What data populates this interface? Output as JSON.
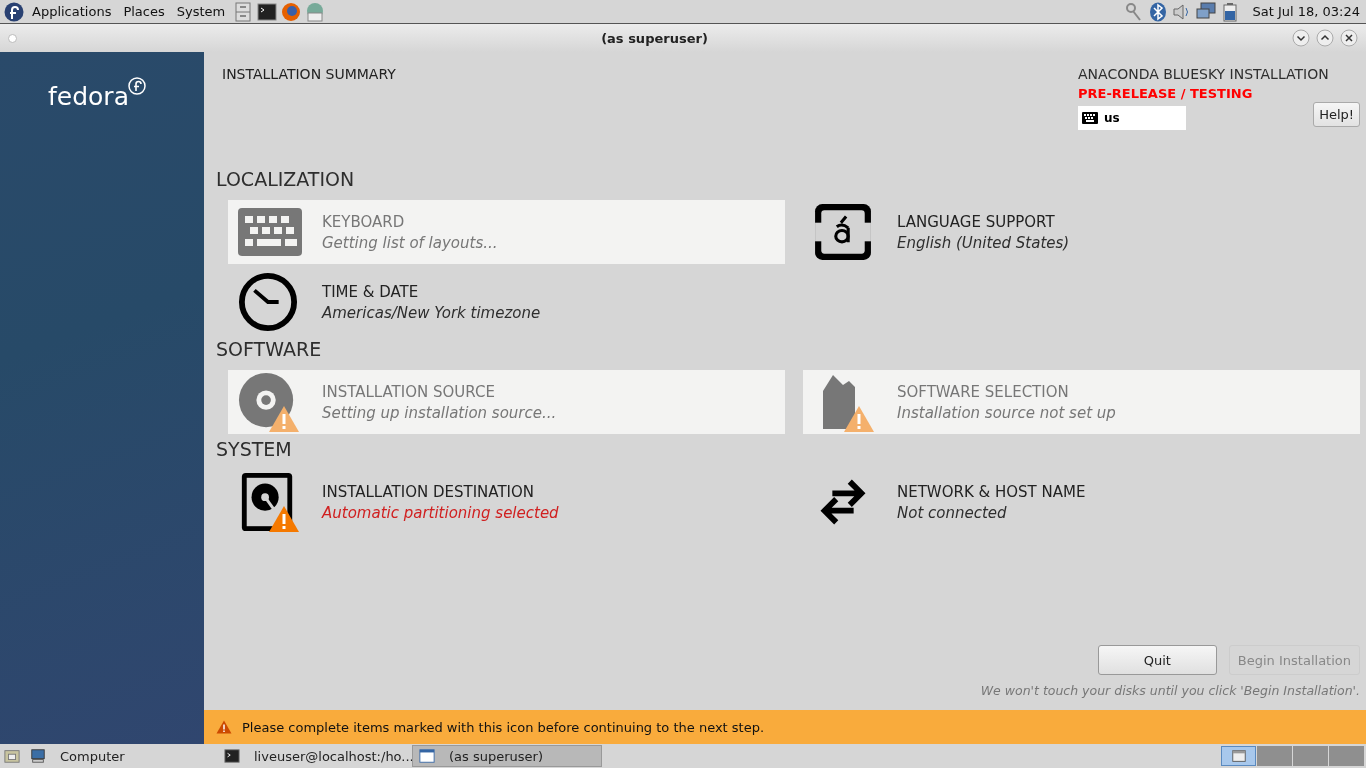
{
  "top_panel": {
    "menus": [
      "Applications",
      "Places",
      "System"
    ],
    "clock": "Sat Jul 18, 03:24"
  },
  "window": {
    "title": "(as superuser)"
  },
  "sidebar": {
    "logo_text": "fedora"
  },
  "header": {
    "title": "INSTALLATION SUMMARY",
    "product": "ANACONDA BLUESKY INSTALLATION",
    "prerelease": "PRE-RELEASE / TESTING",
    "layout": "us",
    "help": "Help!"
  },
  "sections": [
    {
      "title": "LOCALIZATION",
      "spokes": [
        {
          "kind": "keyboard",
          "title": "KEYBOARD",
          "status": "Getting list of layouts...",
          "disabled": true,
          "warning": false,
          "error": false
        },
        {
          "kind": "language",
          "title": "LANGUAGE SUPPORT",
          "status": "English (United States)",
          "disabled": false,
          "warning": false,
          "error": false
        },
        {
          "kind": "clock",
          "title": "TIME & DATE",
          "status": "Americas/New York timezone",
          "disabled": false,
          "warning": false,
          "error": false
        }
      ]
    },
    {
      "title": "SOFTWARE",
      "spokes": [
        {
          "kind": "disc",
          "title": "INSTALLATION SOURCE",
          "status": "Setting up installation source...",
          "disabled": true,
          "warning": true,
          "error": false
        },
        {
          "kind": "package",
          "title": "SOFTWARE SELECTION",
          "status": "Installation source not set up",
          "disabled": true,
          "warning": true,
          "error": false
        }
      ]
    },
    {
      "title": "SYSTEM",
      "spokes": [
        {
          "kind": "disk",
          "title": "INSTALLATION DESTINATION",
          "status": "Automatic partitioning selected",
          "disabled": false,
          "warning": true,
          "error": true
        },
        {
          "kind": "network",
          "title": "NETWORK & HOST NAME",
          "status": "Not connected",
          "disabled": false,
          "warning": false,
          "error": false
        }
      ]
    }
  ],
  "buttons": [
    {
      "label": "Quit",
      "disabled": false
    },
    {
      "label": "Begin Installation",
      "disabled": true
    }
  ],
  "note": "We won't touch your disks until you click 'Begin Installation'.",
  "warning_bar": "Please complete items marked with this icon before continuing to the next step.",
  "taskbar": {
    "items": [
      {
        "label": "Computer",
        "kind": "computer",
        "selected": false
      },
      {
        "label": "liveuser@localhost:/ho...",
        "kind": "terminal",
        "selected": false
      },
      {
        "label": "(as superuser)",
        "kind": "window",
        "selected": true
      }
    ],
    "workspaces": [
      {
        "selected": true
      },
      {
        "selected": false
      },
      {
        "selected": false
      },
      {
        "selected": false
      }
    ]
  }
}
